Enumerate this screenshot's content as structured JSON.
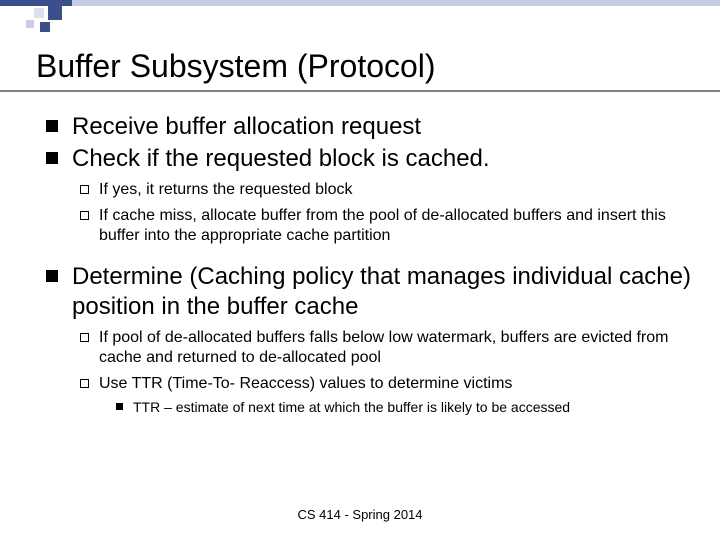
{
  "title": "Buffer Subsystem (Protocol)",
  "section1": {
    "item1": "Receive buffer allocation request",
    "item2": "Check if the requested block is cached.",
    "sub1": "If yes, it returns the requested block",
    "sub2": "If cache miss, allocate buffer from the pool of de-allocated buffers and insert this buffer into the appropriate cache partition"
  },
  "section2": {
    "item1": "Determine (Caching policy that manages individual cache)  position in the buffer cache",
    "sub1": "If pool of de-allocated buffers falls below low watermark, buffers are evicted from cache and returned to de-allocated pool",
    "sub2": "Use TTR (Time-To- Reaccess) values to determine victims",
    "subsub1": "TTR – estimate of next time at which the buffer is likely to be accessed"
  },
  "footer": "CS 414 - Spring 2014"
}
